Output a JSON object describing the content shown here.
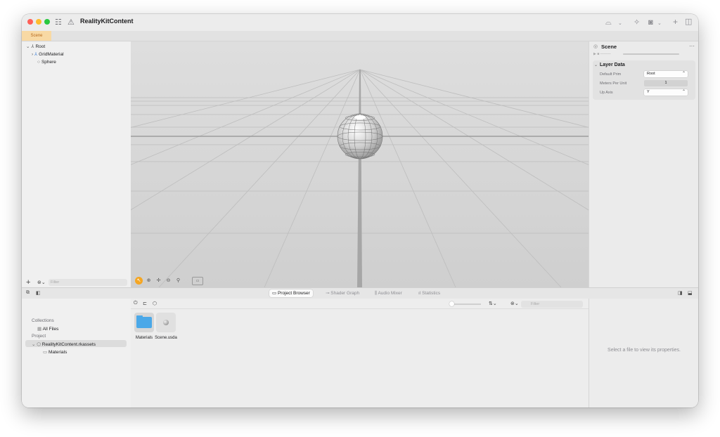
{
  "window": {
    "title": "RealityKitContent"
  },
  "tabs": [
    {
      "label": "Scene"
    }
  ],
  "outline": {
    "items": [
      {
        "label": "Root"
      },
      {
        "label": "GridMaterial"
      },
      {
        "label": "Sphere"
      }
    ],
    "filter_placeholder": "Filter"
  },
  "inspector": {
    "title": "Scene",
    "section_title": "Layer Data",
    "properties": [
      {
        "label": "Default Prim",
        "value": "Root"
      },
      {
        "label": "Meters Per Unit",
        "value": "1"
      },
      {
        "label": "Up Axis",
        "value": "Y"
      }
    ]
  },
  "bottom_tabs": [
    {
      "label": "Project Browser",
      "icon": "folder-icon"
    },
    {
      "label": "Shader Graph",
      "icon": "graph-icon"
    },
    {
      "label": "Audio Mixer",
      "icon": "sliders-icon"
    },
    {
      "label": "Statistics",
      "icon": "bar-chart-icon"
    }
  ],
  "collections": {
    "heading": "Collections",
    "all_files": "All Files",
    "project_heading": "Project",
    "project_name": "RealityKitContent.rkassets",
    "materials": "Materials"
  },
  "files": {
    "filter_placeholder": "Filter",
    "items": [
      {
        "label": "Materials",
        "kind": "folder"
      },
      {
        "label": "Scene.usda",
        "kind": "scene"
      }
    ]
  },
  "properties_panel": {
    "empty_text": "Select a file to view its properties."
  },
  "colors": {
    "accent": "#f5a623",
    "tab_active_bg": "#f8d9a4",
    "folder": "#4aa8e8"
  }
}
